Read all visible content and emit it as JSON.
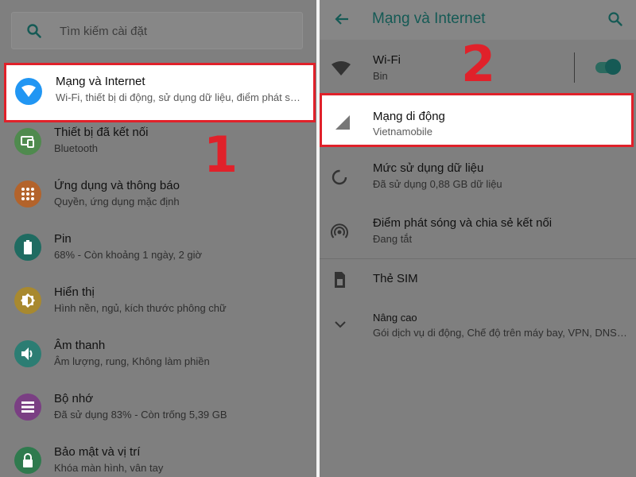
{
  "left": {
    "search_placeholder": "Tìm kiếm cài đặt",
    "items": [
      {
        "title": "Mạng và Internet",
        "subtitle": "Wi-Fi, thiết bị di động, sử dụng dữ liệu, điểm phát s…",
        "icon": "wifi-icon",
        "color": "#2196f3"
      },
      {
        "title": "Thiết bị đã kết nối",
        "subtitle": "Bluetooth",
        "icon": "devices-icon",
        "color": "#4caf50"
      },
      {
        "title": "Ứng dụng và thông báo",
        "subtitle": "Quyền, ứng dụng mặc định",
        "icon": "apps-grid-icon",
        "color": "#ff6d1f"
      },
      {
        "title": "Pin",
        "subtitle": "68% - Còn khoảng 1 ngày, 2 giờ",
        "icon": "battery-icon",
        "color": "#00897b"
      },
      {
        "title": "Hiển thị",
        "subtitle": "Hình nền, ngủ, kích thước phông chữ",
        "icon": "brightness-icon",
        "color": "#fbb92c"
      },
      {
        "title": "Âm thanh",
        "subtitle": "Âm lượng, rung, Không làm phiền",
        "icon": "volume-icon",
        "color": "#26a69a"
      },
      {
        "title": "Bộ nhớ",
        "subtitle": "Đã sử dụng 83% - Còn trống 5,39 GB",
        "icon": "storage-icon",
        "color": "#9c27b0"
      },
      {
        "title": "Bảo mật và vị trí",
        "subtitle": "Khóa màn hình, vân tay",
        "icon": "lock-icon",
        "color": "#26a65b"
      }
    ],
    "step": "1"
  },
  "right": {
    "header_title": "Mạng và Internet",
    "wifi": {
      "title": "Wi-Fi",
      "subtitle": "Bin",
      "enabled": true
    },
    "mobile": {
      "title": "Mạng di động",
      "subtitle": "Vietnamobile"
    },
    "data_usage": {
      "title": "Mức sử dụng dữ liệu",
      "subtitle": "Đã sử dụng 0,88 GB dữ liệu"
    },
    "hotspot": {
      "title": "Điểm phát sóng và chia sẻ kết nối",
      "subtitle": "Đang tắt"
    },
    "sim": {
      "title": "Thẻ SIM"
    },
    "advanced": {
      "title": "Nâng cao",
      "subtitle": "Gói dịch vụ di động, Chế độ trên máy bay, VPN, DNS…"
    },
    "step": "2"
  },
  "colors": {
    "highlight": "#e0212a",
    "accent": "#155a55"
  }
}
